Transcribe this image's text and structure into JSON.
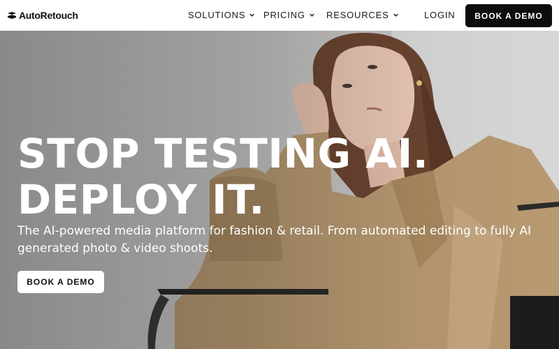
{
  "brand": {
    "name": "AutoRetouch"
  },
  "nav": {
    "items": [
      {
        "label": "SOLUTIONS"
      },
      {
        "label": "PRICING"
      },
      {
        "label": "RESOURCES"
      }
    ],
    "login_label": "LOGIN",
    "cta_label": "BOOK A DEMO"
  },
  "hero": {
    "headline_line1": "STOP TESTING AI.",
    "headline_line2": "DEPLOY IT.",
    "subtitle": "The AI-powered media platform for fashion & retail. From automated editing to fully AI generated photo & video shoots.",
    "cta_label": "BOOK A DEMO"
  },
  "colors": {
    "nav_background": "#ffffff",
    "cta_dark": "#0c0c0c",
    "coat": "#b89a72",
    "hair": "#6b4530"
  },
  "icons": [
    "logo-mark-icon",
    "chevron-down-icon"
  ]
}
